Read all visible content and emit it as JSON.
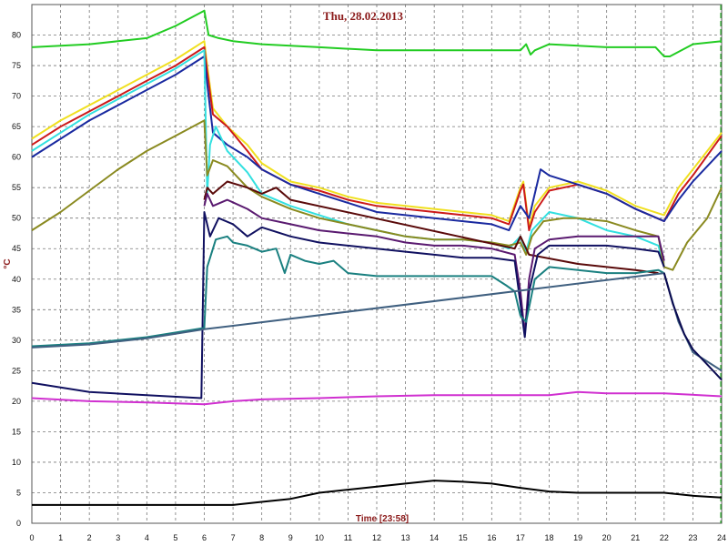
{
  "chart_data": {
    "type": "line",
    "title": "Thu, 28.02.2013",
    "xlabel": "Time [23:58]",
    "ylabel": "°C",
    "xlim": [
      0,
      24
    ],
    "ylim": [
      0,
      85
    ],
    "xticks": [
      0,
      1,
      2,
      3,
      4,
      5,
      6,
      7,
      8,
      9,
      10,
      11,
      12,
      13,
      14,
      15,
      16,
      17,
      18,
      19,
      20,
      21,
      22,
      23,
      24
    ],
    "yticks": [
      0,
      5,
      10,
      15,
      20,
      25,
      30,
      35,
      40,
      45,
      50,
      55,
      60,
      65,
      70,
      75,
      80
    ],
    "grid": true,
    "current_time_marker": 23.97,
    "series": [
      {
        "color": "#22cc22",
        "x": [
          0,
          2,
          4,
          5,
          6,
          6.15,
          6.5,
          7,
          8,
          10,
          12,
          14,
          16,
          17,
          17.2,
          17.35,
          17.5,
          18,
          20,
          21.7,
          22,
          22.2,
          23,
          24
        ],
        "y": [
          78,
          78.5,
          79.5,
          81.5,
          84,
          80,
          79.5,
          79,
          78.5,
          78,
          77.5,
          77.5,
          77.5,
          77.5,
          78.5,
          76.8,
          77.5,
          78.5,
          78,
          78,
          76.5,
          76.5,
          78.5,
          79
        ]
      },
      {
        "color": "#f0e020",
        "x": [
          0,
          1,
          2,
          3,
          4,
          5,
          6,
          6.1,
          6.3,
          6.8,
          7.5,
          8,
          9,
          10,
          11,
          12,
          13,
          14,
          15,
          16,
          16.6,
          17,
          17.1,
          17.3,
          17.5,
          18,
          19,
          20,
          21,
          22,
          22.5,
          23,
          24
        ],
        "y": [
          63,
          66,
          68.5,
          71,
          73.5,
          76,
          79,
          75,
          68,
          65,
          62,
          59,
          56,
          55,
          53.5,
          52.5,
          52,
          51.5,
          51,
          50.5,
          49.5,
          55,
          56,
          48.5,
          52,
          55,
          56,
          54.5,
          52,
          50.5,
          55,
          58,
          64
        ]
      },
      {
        "color": "#cc1a1a",
        "x": [
          0,
          1,
          2,
          3,
          4,
          5,
          6,
          6.1,
          6.3,
          6.8,
          7.5,
          8,
          9,
          10,
          11,
          12,
          13,
          14,
          15,
          16,
          16.6,
          17,
          17.1,
          17.3,
          17.5,
          18,
          19,
          20,
          21,
          22,
          22.5,
          23,
          24
        ],
        "y": [
          62,
          65,
          67.5,
          70,
          72.5,
          75,
          78,
          74,
          67,
          65,
          61,
          58,
          55.5,
          54.5,
          53,
          52,
          51.5,
          51,
          50.5,
          50,
          49,
          54.5,
          55.5,
          48,
          51,
          54.5,
          55.5,
          54,
          51.5,
          49.5,
          54,
          57,
          63.5
        ]
      },
      {
        "color": "#1a2aa0",
        "x": [
          0,
          1,
          2,
          3,
          4,
          5,
          6,
          6.1,
          6.3,
          6.8,
          7.5,
          8,
          9,
          10,
          11,
          12,
          13,
          14,
          15,
          16,
          16.6,
          17,
          17.3,
          17.7,
          18,
          19,
          20,
          21,
          22,
          22.5,
          23,
          24
        ],
        "y": [
          60,
          63,
          66,
          68.5,
          71,
          73.5,
          76.5,
          72,
          64,
          62,
          60,
          58,
          55.5,
          54,
          52.5,
          51,
          50.5,
          50,
          49.5,
          49,
          48,
          52,
          50,
          58,
          57,
          55.5,
          54,
          51.5,
          49.5,
          53,
          56,
          61
        ]
      },
      {
        "color": "#33e0e0",
        "x": [
          0,
          1,
          2,
          3,
          4,
          5,
          6,
          6.1,
          6.2,
          6.4,
          6.8,
          7.5,
          8,
          9,
          10,
          11,
          12,
          13,
          14,
          15,
          16,
          16.6,
          17,
          17.2,
          17.4,
          18,
          19,
          20,
          21,
          21.8,
          22
        ],
        "y": [
          61,
          64,
          67,
          69.5,
          72,
          74.5,
          77.5,
          54,
          62,
          65,
          61,
          57.5,
          54,
          52,
          50.5,
          49,
          48,
          47,
          46.5,
          46.5,
          46,
          45,
          47,
          44.5,
          48,
          51,
          50,
          48,
          47,
          45.5,
          42
        ]
      },
      {
        "color": "#8a8a20",
        "x": [
          0,
          1,
          2,
          3,
          4,
          5,
          6,
          6.1,
          6.3,
          6.8,
          7.5,
          8,
          9,
          10,
          11,
          12,
          13,
          14,
          15,
          16,
          16.6,
          17,
          17.2,
          17.4,
          17.8,
          18.5,
          19,
          20,
          21,
          21.8,
          22,
          22.3,
          22.8,
          23.5,
          24
        ],
        "y": [
          48,
          51,
          54.5,
          58,
          61,
          63.5,
          66,
          57,
          59.5,
          58.5,
          55,
          53.5,
          51.5,
          50,
          49,
          48,
          47,
          46.5,
          46.5,
          46,
          45.5,
          46,
          44,
          47,
          49.5,
          50,
          50,
          49.5,
          48,
          47,
          42,
          41.5,
          46,
          50,
          55
        ]
      },
      {
        "color": "#5a0a0a",
        "x": [
          6,
          6.1,
          6.3,
          6.8,
          7.5,
          8,
          8.5,
          9,
          16.8,
          17,
          17.3,
          19,
          20,
          21,
          21.8
        ],
        "y": [
          53,
          55,
          54,
          56,
          55,
          54,
          55,
          53,
          45,
          47,
          44,
          42.5,
          42,
          41.5,
          41
        ]
      },
      {
        "color": "#5a1a70",
        "x": [
          6,
          6.1,
          6.3,
          6.8,
          7.5,
          8,
          9,
          10,
          11,
          12,
          13,
          14,
          15,
          16,
          16.8,
          17,
          17.15,
          17.3,
          17.5,
          18,
          19,
          20,
          21,
          21.8,
          22
        ],
        "y": [
          52,
          54,
          52,
          53,
          51.5,
          50,
          49,
          48,
          47.5,
          47,
          46,
          45.5,
          45.5,
          45,
          44,
          38,
          31,
          40,
          45,
          46.5,
          47,
          47,
          47,
          47,
          43
        ]
      },
      {
        "color": "#101060",
        "x": [
          0,
          2,
          4,
          5.9,
          6,
          6.2,
          6.5,
          7,
          7.5,
          8,
          9,
          10,
          11,
          12,
          13,
          14,
          15,
          16,
          16.8,
          17,
          17.15,
          17.3,
          17.6,
          18,
          19,
          20,
          21,
          21.8,
          22
        ],
        "y": [
          23,
          21.5,
          21,
          20.5,
          51,
          47,
          50,
          49,
          47,
          48.5,
          47,
          46,
          45.5,
          45,
          44.5,
          44,
          43.5,
          43.5,
          43,
          36,
          30.5,
          38,
          44,
          45.5,
          45.5,
          45.5,
          45,
          44.5,
          42
        ]
      },
      {
        "color": "#1a8080",
        "x": [
          0,
          2,
          4,
          6,
          6.1,
          6.4,
          6.8,
          7,
          7.5,
          8,
          8.5,
          8.8,
          9,
          9.5,
          10,
          10.5,
          11,
          12,
          13,
          14,
          15,
          16,
          16.5,
          16.8,
          17,
          17.2,
          17.5,
          18,
          19,
          20,
          21,
          21.8,
          22
        ],
        "y": [
          29,
          29.5,
          30.5,
          32,
          42,
          46.5,
          47,
          46,
          45.5,
          44.5,
          45,
          41,
          44,
          43,
          42.5,
          43,
          41,
          40.5,
          40.5,
          40.5,
          40.5,
          40.5,
          39,
          38,
          34,
          33,
          40,
          42,
          41.5,
          41,
          41,
          41.5,
          41
        ]
      },
      {
        "color": "#406080",
        "x": [
          0,
          2,
          4,
          6,
          22,
          22.5,
          23,
          24
        ],
        "y": [
          28.8,
          29.3,
          30.3,
          31.8,
          41,
          33,
          28,
          25
        ]
      },
      {
        "color": "#0a0a50",
        "x": [
          22,
          22.3,
          22.7,
          23,
          23.5,
          24
        ],
        "y": [
          41,
          36,
          31,
          28.5,
          26,
          23.5
        ]
      },
      {
        "color": "#d030d0",
        "x": [
          0,
          2,
          4,
          6,
          7,
          8,
          10,
          12,
          14,
          16,
          18,
          19,
          20,
          22,
          24
        ],
        "y": [
          20.5,
          20,
          19.8,
          19.5,
          20,
          20.3,
          20.5,
          20.8,
          21,
          21,
          21,
          21.5,
          21.3,
          21.3,
          20.8
        ]
      },
      {
        "color": "#000000",
        "x": [
          0,
          1,
          2,
          3,
          4,
          5,
          6,
          7,
          8,
          9,
          10,
          11,
          12,
          13,
          14,
          15,
          16,
          17,
          18,
          19,
          20,
          21,
          22,
          23,
          24
        ],
        "y": [
          3,
          3,
          3,
          3,
          3,
          3,
          3,
          3,
          3.5,
          4,
          5,
          5.5,
          6,
          6.5,
          7,
          6.8,
          6.5,
          5.8,
          5.2,
          5,
          5,
          5,
          5,
          4.5,
          4.2
        ]
      }
    ]
  }
}
